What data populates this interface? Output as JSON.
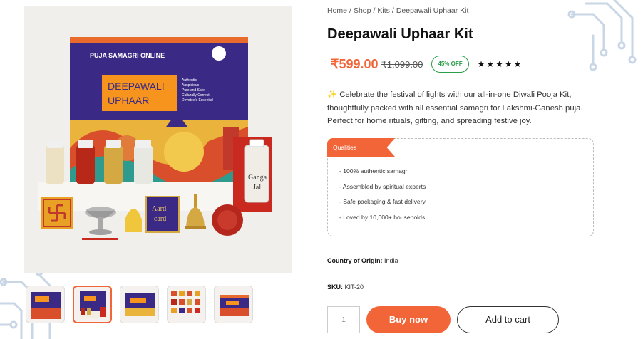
{
  "breadcrumb": {
    "items": [
      "Home",
      "Shop",
      "Kits",
      "Deepawali Uphaar Kit"
    ],
    "separator": "/"
  },
  "product": {
    "title": "Deepawali Uphaar Kit",
    "price": "₹599.00",
    "old_price": "₹1,099.00",
    "discount_badge": "45% OFF",
    "rating_stars": "★★★★★",
    "description_icon": "✨",
    "description": "Celebrate the festival of lights with our all-in-one Diwali Pooja Kit, thoughtfully packed with all essential samagri for Lakshmi-Ganesh puja. Perfect for home rituals, gifting, and spreading festive joy.",
    "qualities_title": "Qualities",
    "qualities": [
      "- 100% authentic samagri",
      "- Assembled by spiritual experts",
      "- Safe packaging & fast delivery",
      "- Loved by 10,000+ households"
    ],
    "country_label": "Country of Origin:",
    "country_value": "India",
    "sku_label": "SKU:",
    "sku_value": "KIT-20",
    "quantity": "1",
    "buy_label": "Buy now",
    "cart_label": "Add to cart"
  },
  "box_art": {
    "brand": "PUJA SAMAGRI ONLINE",
    "kit_name_line1": "DEEPAWALI",
    "kit_name_line2": "UPHAAR",
    "features": [
      "Authentic",
      "Auspicious",
      "Pure and Safe",
      "Culturally Correct",
      "Devotee's Essential"
    ],
    "ganga_jal_line1": "Ganga",
    "ganga_jal_line2": "Jal",
    "aarti_line1": "Aarti",
    "aarti_line2": "card"
  },
  "colors": {
    "accent": "#f26538",
    "badge_green": "#2a9d4a",
    "box_purple": "#3b2a85"
  }
}
